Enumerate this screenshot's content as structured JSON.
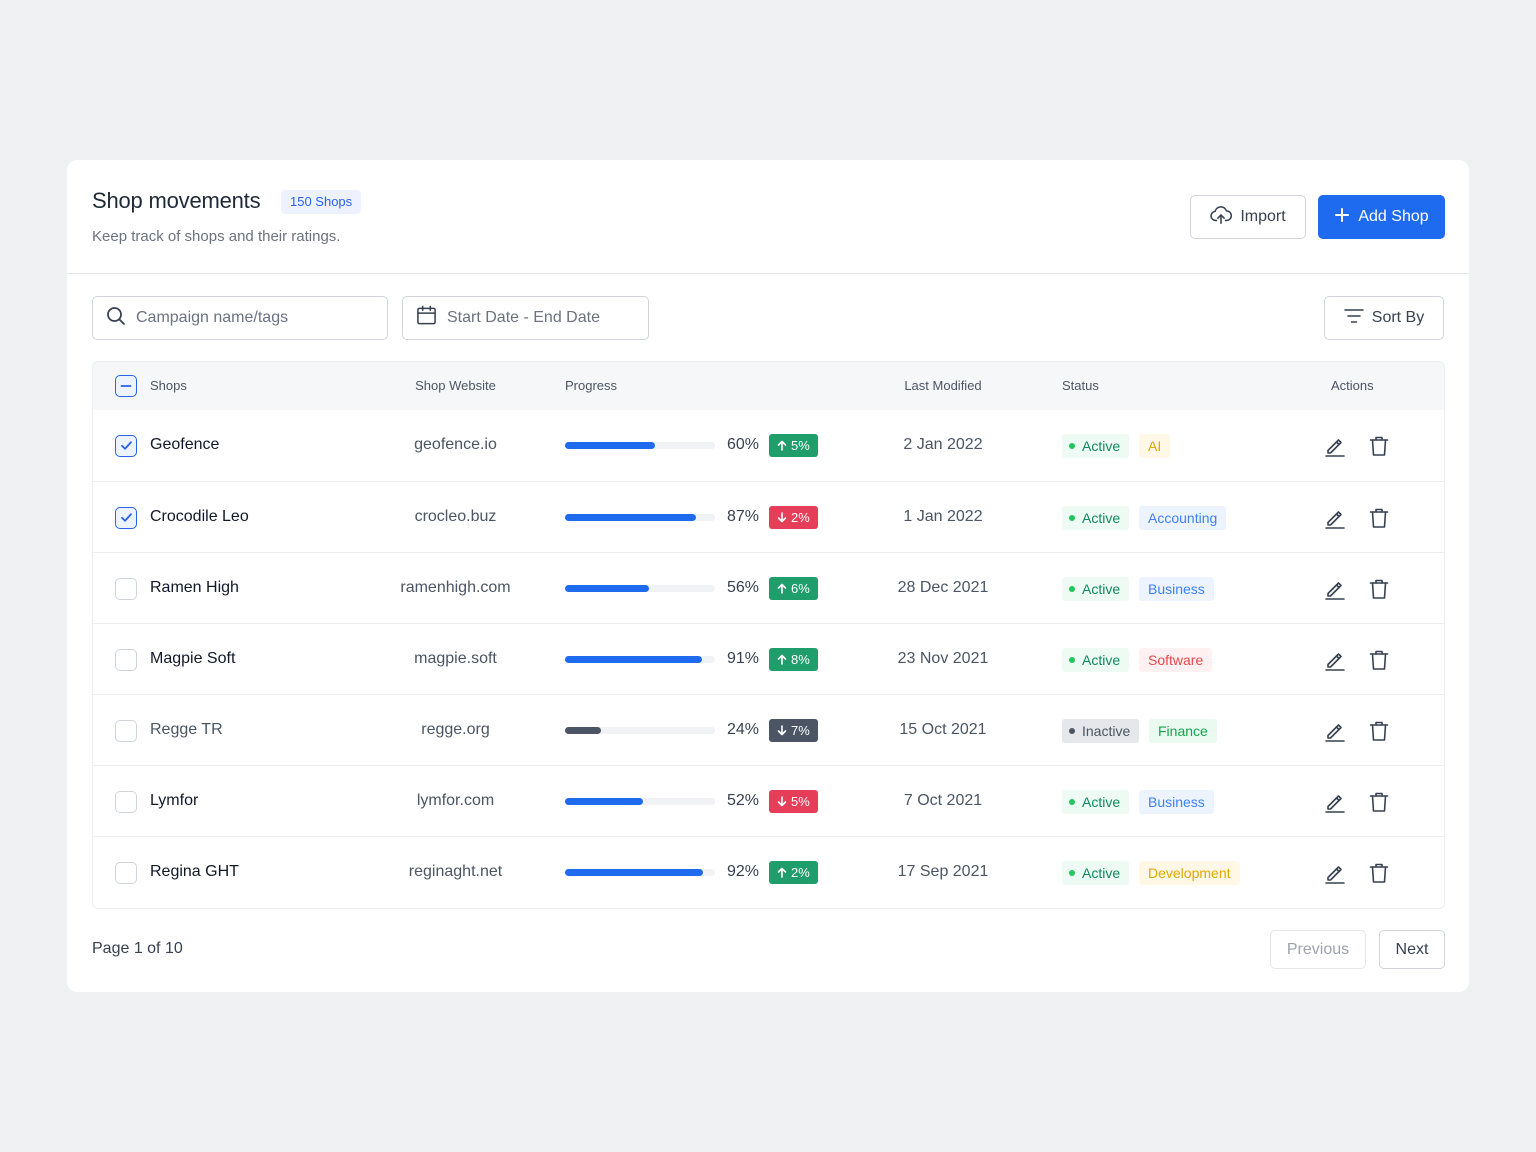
{
  "header": {
    "title": "Shop movements",
    "count_badge": "150 Shops",
    "subtitle": "Keep track of shops and their ratings.",
    "import_label": "Import",
    "add_label": "Add Shop"
  },
  "filters": {
    "search_placeholder": "Campaign name/tags",
    "date_placeholder": "Start Date - End Date",
    "sort_label": "Sort By"
  },
  "columns": {
    "shops": "Shops",
    "website": "Shop Website",
    "progress": "Progress",
    "modified": "Last Modified",
    "status": "Status",
    "actions": "Actions"
  },
  "rows": [
    {
      "name": "Geofence",
      "checked": true,
      "website": "geofence.io",
      "progress": 60,
      "progress_text": "60%",
      "delta": "5%",
      "trend": "up",
      "modified": "2 Jan 2022",
      "status": "Active",
      "tag": "AI",
      "tag_bg": "#fff8e6",
      "tag_fg": "#e0a800"
    },
    {
      "name": "Crocodile Leo",
      "checked": true,
      "website": "crocleo.buz",
      "progress": 87,
      "progress_text": "87%",
      "delta": "2%",
      "trend": "down",
      "modified": "1 Jan 2022",
      "status": "Active",
      "tag": "Accounting",
      "tag_bg": "#eef4ff",
      "tag_fg": "#3b82f6"
    },
    {
      "name": "Ramen High",
      "checked": false,
      "website": "ramenhigh.com",
      "progress": 56,
      "progress_text": "56%",
      "delta": "6%",
      "trend": "up",
      "modified": "28 Dec 2021",
      "status": "Active",
      "tag": "Business",
      "tag_bg": "#eef4ff",
      "tag_fg": "#3b82f6"
    },
    {
      "name": "Magpie Soft",
      "checked": false,
      "website": "magpie.soft",
      "progress": 91,
      "progress_text": "91%",
      "delta": "8%",
      "trend": "up",
      "modified": "23 Nov 2021",
      "status": "Active",
      "tag": "Software",
      "tag_bg": "#fff0f1",
      "tag_fg": "#e5484d"
    },
    {
      "name": "Regge TR",
      "checked": false,
      "website": "regge.org",
      "progress": 24,
      "progress_text": "24%",
      "delta": "7%",
      "trend": "flat",
      "modified": "15 Oct 2021",
      "status": "Inactive",
      "tag": "Finance",
      "tag_bg": "#eafaf1",
      "tag_fg": "#16a34a"
    },
    {
      "name": "Lymfor",
      "checked": false,
      "website": "lymfor.com",
      "progress": 52,
      "progress_text": "52%",
      "delta": "5%",
      "trend": "down",
      "modified": "7 Oct 2021",
      "status": "Active",
      "tag": "Business",
      "tag_bg": "#eef4ff",
      "tag_fg": "#3b82f6"
    },
    {
      "name": "Regina GHT",
      "checked": false,
      "website": "reginaght.net",
      "progress": 92,
      "progress_text": "92%",
      "delta": "2%",
      "trend": "up",
      "modified": "17 Sep 2021",
      "status": "Active",
      "tag": "Development",
      "tag_bg": "#fff8e6",
      "tag_fg": "#e0a800"
    }
  ],
  "pagination": {
    "text": "Page 1 of 10",
    "previous_label": "Previous",
    "next_label": "Next"
  },
  "colors": {
    "primary": "#1f6bf0",
    "up": "#1f9d6a",
    "down": "#e63e58",
    "neutral": "#4b5563"
  },
  "icons": {
    "import": "cloud-upload-icon",
    "add": "plus-icon",
    "search": "search-icon",
    "date": "calendar-icon",
    "sort": "filter-lines-icon",
    "edit": "pencil-icon",
    "delete": "trash-icon",
    "trend_up": "arrow-up-icon",
    "trend_down": "arrow-down-icon"
  }
}
